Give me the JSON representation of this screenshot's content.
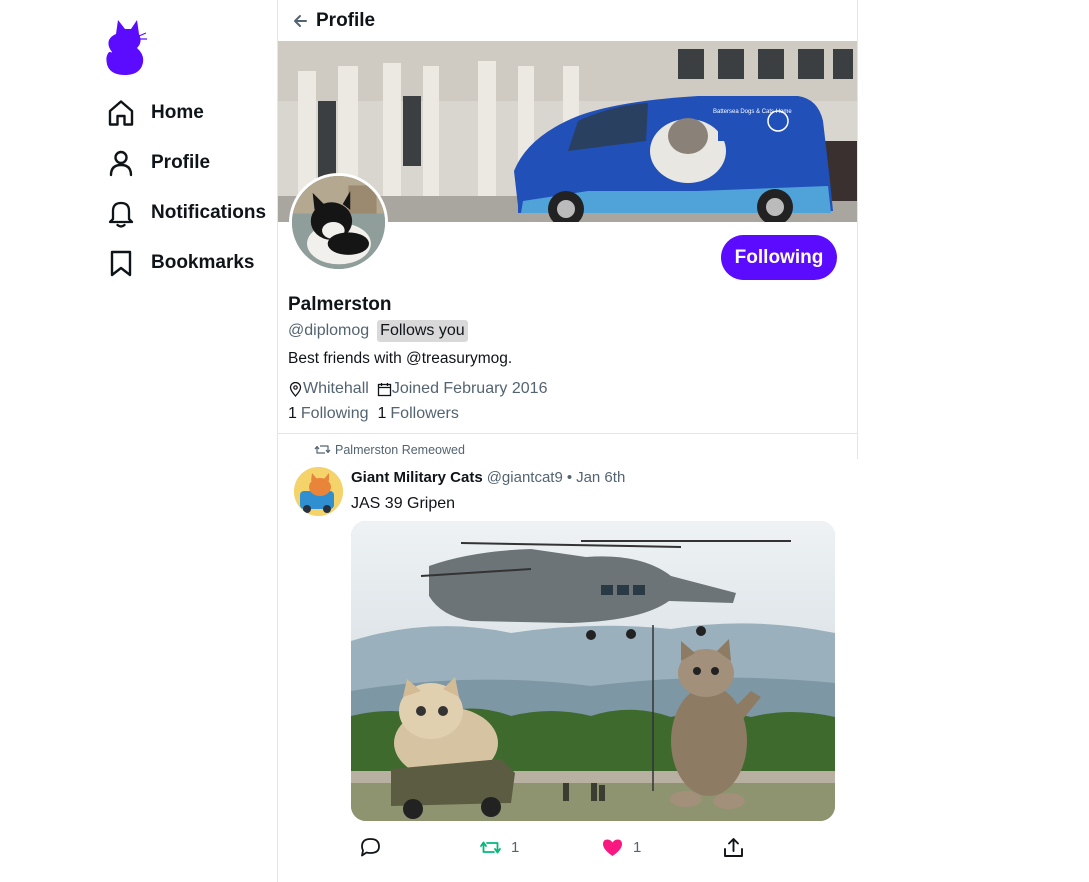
{
  "brand": {
    "accent": "#5b0cff",
    "logo_icon": "cat-logo-icon"
  },
  "nav": {
    "items": [
      {
        "label": "Home",
        "icon": "home-icon"
      },
      {
        "label": "Profile",
        "icon": "user-icon"
      },
      {
        "label": "Notifications",
        "icon": "bell-icon"
      },
      {
        "label": "Bookmarks",
        "icon": "bookmark-icon"
      }
    ]
  },
  "header": {
    "title": "Profile",
    "back_icon": "arrow-left-icon"
  },
  "profile": {
    "follow_button": "Following",
    "display_name": "Palmerston",
    "handle": "@diplomog",
    "follows_you": "Follows you",
    "bio": "Best friends with @treasurymog.",
    "location": "Whitehall",
    "joined": "Joined February 2016",
    "following_count": "1",
    "following_label": "Following",
    "followers_count": "1",
    "followers_label": "Followers",
    "banner_van_text": "Battersea Dogs & Cats Home"
  },
  "feed": {
    "remeow_text": "Palmerston Remeowed",
    "post": {
      "author": "Giant Military Cats",
      "handle": "@giantcat9",
      "separator": "•",
      "date": "Jan 6th",
      "text": "JAS 39 Gripen",
      "reply_count": "",
      "remeow_count": "1",
      "like_count": "1",
      "colors": {
        "remeow": "#00ba7c",
        "like": "#f91880"
      }
    }
  }
}
